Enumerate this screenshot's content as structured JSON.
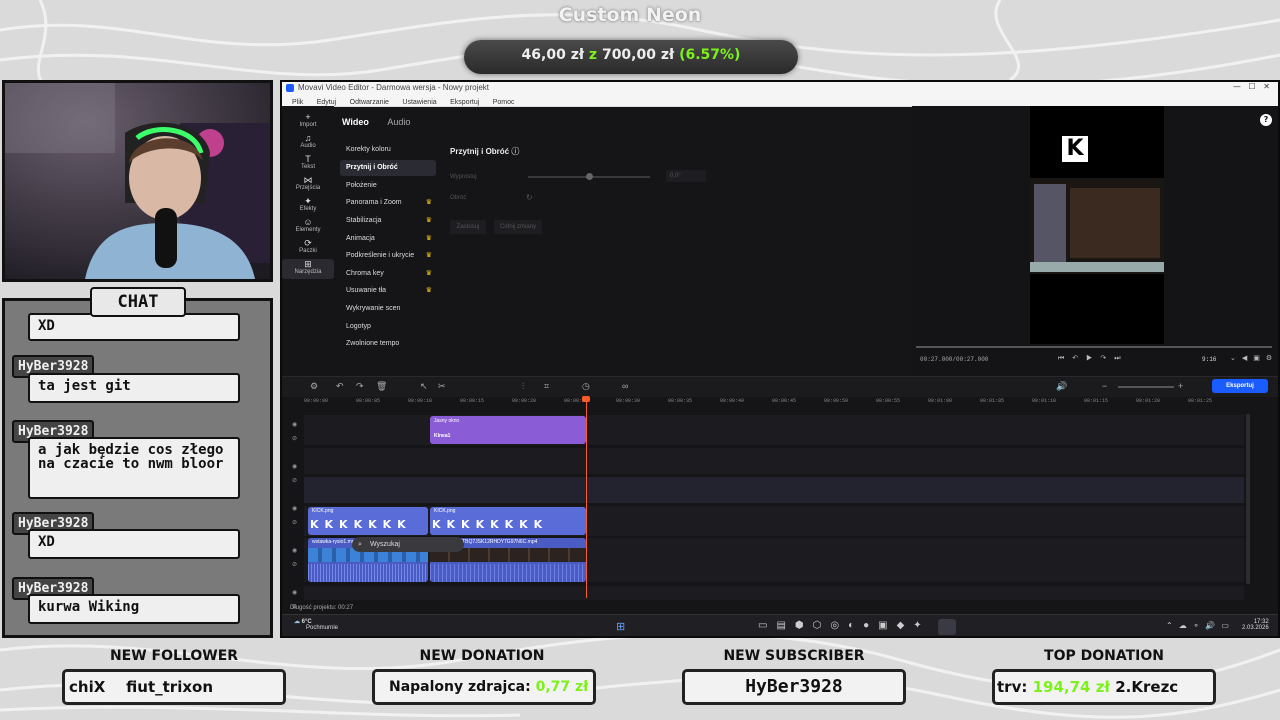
{
  "overlay": {
    "goal_title": "Custom Neon",
    "goal_current": "46,00 zł",
    "goal_sep": "z",
    "goal_target": "700,00 zł",
    "goal_percent": "(6.57%)",
    "accent_green": "#7cf21a"
  },
  "chat": {
    "header": "CHAT",
    "messages": [
      {
        "user": "",
        "text": "XD"
      },
      {
        "user": "HyBer3928",
        "text": "ta jest git"
      },
      {
        "user": "HyBer3928",
        "text": "a jak będzie cos złego na czacie to nwm bloor"
      },
      {
        "user": "HyBer3928",
        "text": "XD"
      },
      {
        "user": "HyBer3928",
        "text": "kurwa Wiking"
      }
    ]
  },
  "editor": {
    "title": "Movavi Video Editor - Darmowa wersja - Nowy projekt",
    "menu": [
      "Plik",
      "Edytuj",
      "Odtwarzanie",
      "Ustawienia",
      "Eksportuj",
      "Pomoc"
    ],
    "rail": [
      {
        "icon": "+",
        "label": "Import"
      },
      {
        "icon": "♫",
        "label": "Audio"
      },
      {
        "icon": "T",
        "label": "Tekst"
      },
      {
        "icon": "⋈",
        "label": "Przejścia"
      },
      {
        "icon": "✦",
        "label": "Efekty"
      },
      {
        "icon": "☺",
        "label": "Elementy"
      },
      {
        "icon": "⟳",
        "label": "Paczki"
      },
      {
        "icon": "⊞",
        "label": "Narzędzia"
      }
    ],
    "tabs": [
      "Wideo",
      "Audio"
    ],
    "tools": [
      {
        "label": "Korekty koloru",
        "premium": false,
        "active": false
      },
      {
        "label": "Przytnij i Obróć",
        "premium": false,
        "active": true
      },
      {
        "label": "Położenie",
        "premium": false,
        "active": false
      },
      {
        "label": "Panorama i Zoom",
        "premium": true,
        "active": false
      },
      {
        "label": "Stabilizacja",
        "premium": true,
        "active": false
      },
      {
        "label": "Animacja",
        "premium": true,
        "active": false
      },
      {
        "label": "Podkreślenie i ukrycie",
        "premium": true,
        "active": false
      },
      {
        "label": "Chroma key",
        "premium": true,
        "active": false
      },
      {
        "label": "Usuwanie tła",
        "premium": true,
        "active": false
      },
      {
        "label": "Wykrywanie scen",
        "premium": false,
        "active": false
      },
      {
        "label": "Logotyp",
        "premium": false,
        "active": false
      },
      {
        "label": "Zwolnione tempo",
        "premium": false,
        "active": false
      }
    ],
    "properties": {
      "title": "Przytnij i Obróć",
      "straighten_label": "Wyprostuj",
      "straighten_value": "0,0°",
      "rotate_label": "Obróć",
      "apply_label": "Zastosuj",
      "undo_label": "Cofnij zmiany"
    },
    "preview": {
      "time": "00:27.000/00:27.000",
      "aspect": "9:16",
      "logo_letter": "K"
    },
    "timeline": {
      "export_label": "Eksportuj",
      "ruler": [
        "00:00:00",
        "00:00:05",
        "00:00:10",
        "00:00:15",
        "00:00:20",
        "00:00:25",
        "00:00:30",
        "00:00:35",
        "00:00:40",
        "00:00:45",
        "00:00:50",
        "00:00:55",
        "00:01:00",
        "00:01:05",
        "00:01:10",
        "00:01:15",
        "00:01:20",
        "00:01:25"
      ],
      "text_clip_top": "Jasny okno",
      "text_clip_name": "Klnea1",
      "img_clip_1": "KICK.png",
      "img_clip_2": "KICK.png",
      "vid_clip_1": "wstawka-rysio1.mp4",
      "vid_clip_2": "clip_01KJ6HTBQ7JSK12RHDY7G97N6C.mp4",
      "project_length": "Długość projektu: 00:27"
    },
    "taskbar": {
      "weather_temp": "6°C",
      "weather_desc": "Pochmurnie",
      "search": "Wyszukaj",
      "time": "17:32",
      "date": "2.03.2026"
    }
  },
  "bottom": {
    "follower_label": "NEW FOLLOWER",
    "follower_text": "chiX    fiut_trixon",
    "donation_label": "NEW DONATION",
    "donation_name": "Napalony zdrajca",
    "donation_amount": "0,77 zł",
    "subscriber_label": "NEW SUBSCRIBER",
    "subscriber_name": "HyBer3928",
    "top_label": "TOP DONATION",
    "top_prefix": "trv:",
    "top_amount": "194,74 zł",
    "top_name": "2.Krezc"
  }
}
